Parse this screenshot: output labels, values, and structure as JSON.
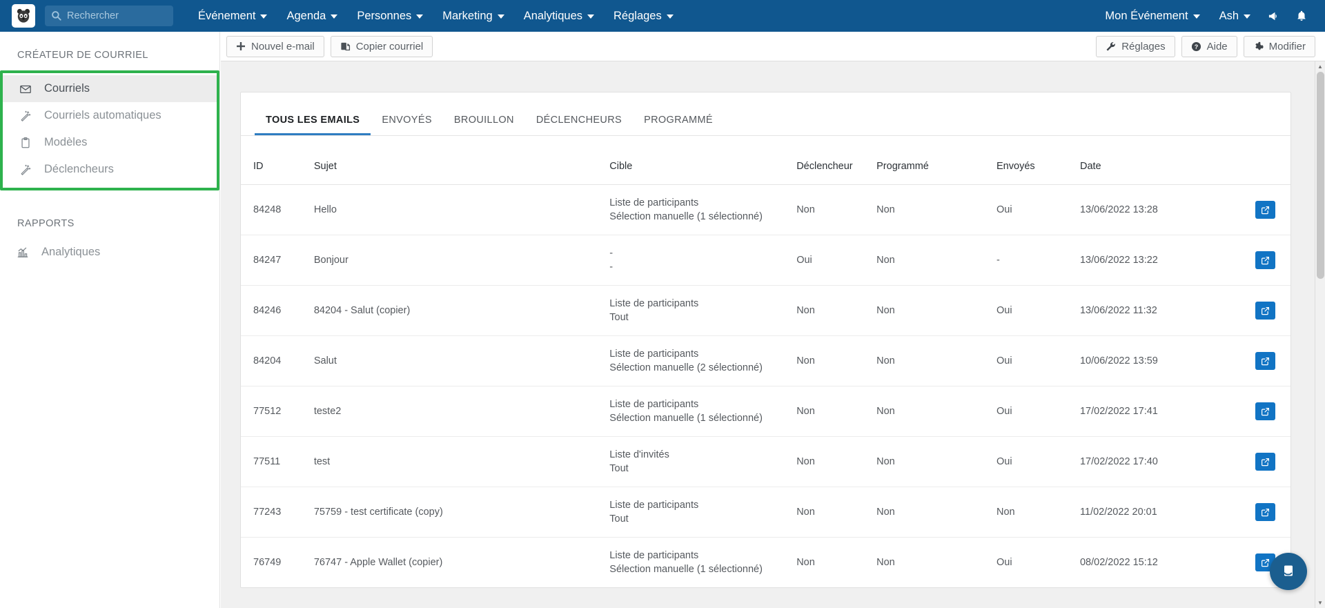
{
  "topnav": {
    "logo_icon": "panda-logo-icon",
    "search": {
      "placeholder": "Rechercher",
      "icon": "search-icon",
      "value": ""
    },
    "menu": [
      {
        "label": "Événement",
        "icon": "chevron-down-icon"
      },
      {
        "label": "Agenda",
        "icon": "chevron-down-icon"
      },
      {
        "label": "Personnes",
        "icon": "chevron-down-icon"
      },
      {
        "label": "Marketing",
        "icon": "chevron-down-icon"
      },
      {
        "label": "Analytiques",
        "icon": "chevron-down-icon"
      },
      {
        "label": "Réglages",
        "icon": "chevron-down-icon"
      }
    ],
    "right": {
      "event_label": "Mon Événement",
      "user_label": "Ash",
      "announce_icon": "megaphone-icon",
      "notification_icon": "bell-icon"
    },
    "bg_color": "#10578f"
  },
  "sidebar": {
    "section_title": "CRÉATEUR DE COURRIEL",
    "highlight_color": "#2eb24d",
    "items": [
      {
        "label": "Courriels",
        "icon": "envelope-icon",
        "active": true
      },
      {
        "label": "Courriels automatiques",
        "icon": "magic-wand-icon",
        "active": false
      },
      {
        "label": "Modèles",
        "icon": "clipboard-icon",
        "active": false
      },
      {
        "label": "Déclencheurs",
        "icon": "magic-wand-icon",
        "active": false
      }
    ],
    "reports_title": "RAPPORTS",
    "reports_items": [
      {
        "label": "Analytiques",
        "icon": "bar-chart-icon"
      }
    ]
  },
  "toolbar": {
    "new_email_label": "Nouvel e-mail",
    "new_email_icon": "plus-icon",
    "copy_email_label": "Copier courriel",
    "copy_email_icon": "copy-icon",
    "settings_label": "Réglages",
    "settings_icon": "wrench-icon",
    "help_label": "Aide",
    "help_icon": "question-circle-icon",
    "edit_label": "Modifier",
    "edit_icon": "gear-icon"
  },
  "tabs": [
    {
      "label": "TOUS LES EMAILS",
      "active": true
    },
    {
      "label": "ENVOYÉS",
      "active": false
    },
    {
      "label": "BROUILLON",
      "active": false
    },
    {
      "label": "DÉCLENCHEURS",
      "active": false
    },
    {
      "label": "PROGRAMMÉ",
      "active": false
    }
  ],
  "table": {
    "columns": [
      "ID",
      "Sujet",
      "Cible",
      "Déclencheur",
      "Programmé",
      "Envoyés",
      "Date",
      ""
    ],
    "row_action_icon": "edit-external-icon",
    "rows": [
      {
        "id": "84248",
        "sujet": "Hello",
        "cible_1": "Liste de participants",
        "cible_2": "Sélection manuelle (1 sélectionné)",
        "declencheur": "Non",
        "programme": "Non",
        "envoyes": "Oui",
        "date": "13/06/2022 13:28"
      },
      {
        "id": "84247",
        "sujet": "Bonjour",
        "cible_1": "-",
        "cible_2": "-",
        "declencheur": "Oui",
        "programme": "Non",
        "envoyes": "-",
        "date": "13/06/2022 13:22"
      },
      {
        "id": "84246",
        "sujet": "84204 - Salut (copier)",
        "cible_1": "Liste de participants",
        "cible_2": "Tout",
        "declencheur": "Non",
        "programme": "Non",
        "envoyes": "Oui",
        "date": "13/06/2022 11:32"
      },
      {
        "id": "84204",
        "sujet": "Salut",
        "cible_1": "Liste de participants",
        "cible_2": "Sélection manuelle (2 sélectionné)",
        "declencheur": "Non",
        "programme": "Non",
        "envoyes": "Oui",
        "date": "10/06/2022 13:59"
      },
      {
        "id": "77512",
        "sujet": "teste2",
        "cible_1": "Liste de participants",
        "cible_2": "Sélection manuelle (1 sélectionné)",
        "declencheur": "Non",
        "programme": "Non",
        "envoyes": "Oui",
        "date": "17/02/2022 17:41"
      },
      {
        "id": "77511",
        "sujet": "test",
        "cible_1": "Liste d'invités",
        "cible_2": "Tout",
        "declencheur": "Non",
        "programme": "Non",
        "envoyes": "Oui",
        "date": "17/02/2022 17:40"
      },
      {
        "id": "77243",
        "sujet": "75759 - test certificate (copy)",
        "cible_1": "Liste de participants",
        "cible_2": "Tout",
        "declencheur": "Non",
        "programme": "Non",
        "envoyes": "Non",
        "date": "11/02/2022 20:01"
      },
      {
        "id": "76749",
        "sujet": "76747 - Apple Wallet (copier)",
        "cible_1": "Liste de participants",
        "cible_2": "Sélection manuelle (1 sélectionné)",
        "declencheur": "Non",
        "programme": "Non",
        "envoyes": "Oui",
        "date": "08/02/2022 15:12"
      }
    ]
  },
  "chat": {
    "icon": "intercom-chat-icon",
    "color": "#1b5e8f"
  }
}
